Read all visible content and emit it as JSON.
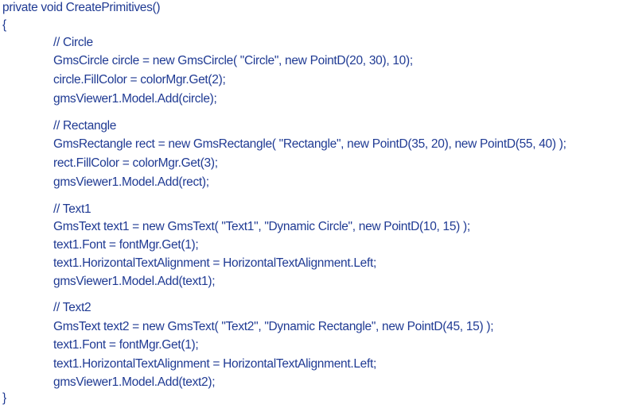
{
  "code": {
    "signature": "private void CreatePrimitives()",
    "open_brace": "{",
    "close_brace": "}",
    "blocks": [
      {
        "comment": "// Circle",
        "lines": [
          "GmsCircle circle = new GmsCircle( \"Circle\", new PointD(20, 30), 10);",
          "circle.FillColor = colorMgr.Get(2);",
          "gmsViewer1.Model.Add(circle);"
        ]
      },
      {
        "comment": "// Rectangle",
        "lines": [
          "GmsRectangle rect = new GmsRectangle( \"Rectangle\", new PointD(35, 20), new PointD(55, 40) );",
          "rect.FillColor = colorMgr.Get(3);",
          "gmsViewer1.Model.Add(rect);"
        ]
      },
      {
        "comment": "// Text1",
        "lines": [
          "GmsText text1 = new GmsText( \"Text1\", \"Dynamic Circle\", new PointD(10, 15) );",
          "text1.Font = fontMgr.Get(1);",
          "text1.HorizontalTextAlignment = HorizontalTextAlignment.Left;",
          "gmsViewer1.Model.Add(text1);"
        ]
      },
      {
        "comment": "// Text2",
        "lines": [
          "GmsText text2 = new GmsText( \"Text2\", \"Dynamic Rectangle\", new PointD(45, 15) );",
          "text1.Font = fontMgr.Get(1);",
          "text1.HorizontalTextAlignment = HorizontalTextAlignment.Left;",
          "gmsViewer1.Model.Add(text2);"
        ]
      }
    ]
  },
  "colors": {
    "text": "#1f3a93",
    "spellcheck_underline": "#c00000",
    "background": "#ffffff"
  }
}
